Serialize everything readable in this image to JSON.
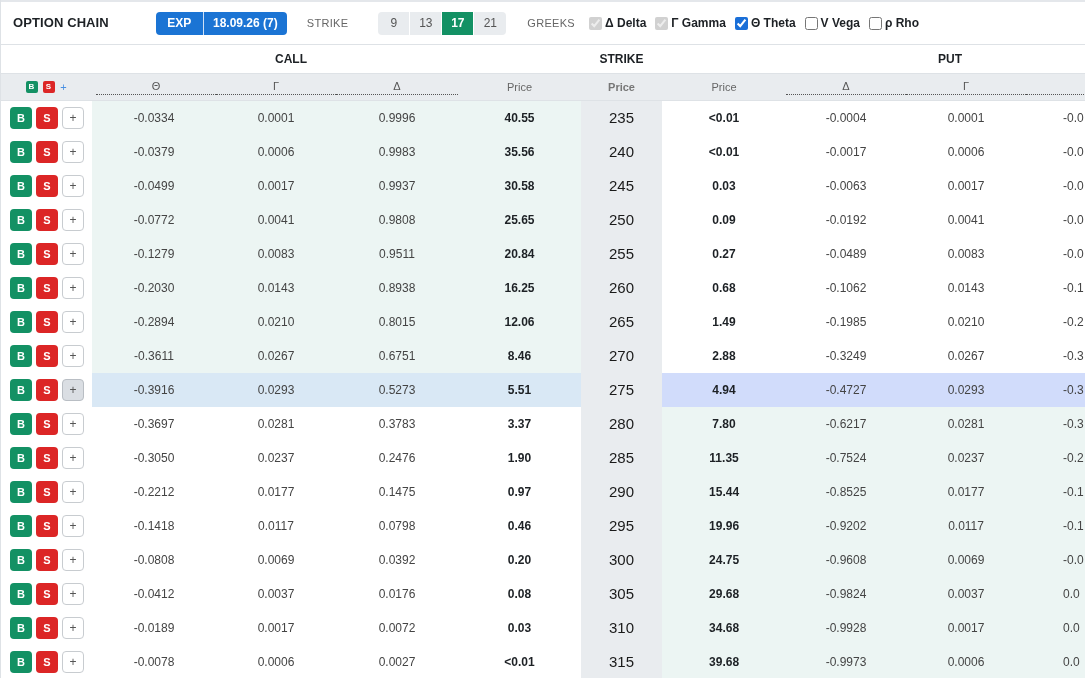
{
  "header": {
    "title": "OPTION CHAIN",
    "expiry": {
      "label": "EXP",
      "value": "18.09.26 (7)"
    },
    "strike_label": "STRIKE",
    "strike_counts": [
      {
        "label": "9",
        "selected": false
      },
      {
        "label": "13",
        "selected": false
      },
      {
        "label": "17",
        "selected": true
      },
      {
        "label": "21",
        "selected": false
      }
    ],
    "greeks_label": "GREEKS",
    "greeks": [
      {
        "label": "Δ Delta",
        "checked": true,
        "disabled": true
      },
      {
        "label": "Γ Gamma",
        "checked": true,
        "disabled": true
      },
      {
        "label": "Θ Theta",
        "checked": true,
        "disabled": false
      },
      {
        "label": "V Vega",
        "checked": false,
        "disabled": false
      },
      {
        "label": "ρ Rho",
        "checked": false,
        "disabled": false
      }
    ]
  },
  "table": {
    "call_title": "CALL",
    "strike_title": "STRIKE",
    "put_title": "PUT",
    "legend": {
      "buy": "B",
      "sell": "S",
      "add": "+"
    },
    "call_columns": [
      {
        "label": "Θ",
        "kind": "greek"
      },
      {
        "label": "Γ",
        "kind": "greek"
      },
      {
        "label": "Δ",
        "kind": "greek"
      },
      {
        "label": "Price",
        "kind": "price"
      }
    ],
    "strike_column": "Price",
    "put_columns": [
      {
        "label": "Price",
        "kind": "price"
      },
      {
        "label": "Δ",
        "kind": "greek"
      },
      {
        "label": "Γ",
        "kind": "greek"
      },
      {
        "kind": "greek"
      }
    ],
    "rows": [
      {
        "buy": "B",
        "sell": "S",
        "add": "+",
        "call": [
          "-0.0334",
          "0.0001",
          "0.9996",
          "40.55"
        ],
        "strike": "235",
        "put": [
          "<0.01",
          "-0.0004",
          "0.0001",
          "-0.0"
        ],
        "call_itm": true,
        "put_itm": false,
        "atm": false
      },
      {
        "buy": "B",
        "sell": "S",
        "add": "+",
        "call": [
          "-0.0379",
          "0.0006",
          "0.9983",
          "35.56"
        ],
        "strike": "240",
        "put": [
          "<0.01",
          "-0.0017",
          "0.0006",
          "-0.0"
        ],
        "call_itm": true,
        "put_itm": false,
        "atm": false
      },
      {
        "buy": "B",
        "sell": "S",
        "add": "+",
        "call": [
          "-0.0499",
          "0.0017",
          "0.9937",
          "30.58"
        ],
        "strike": "245",
        "put": [
          "0.03",
          "-0.0063",
          "0.0017",
          "-0.0"
        ],
        "call_itm": true,
        "put_itm": false,
        "atm": false
      },
      {
        "buy": "B",
        "sell": "S",
        "add": "+",
        "call": [
          "-0.0772",
          "0.0041",
          "0.9808",
          "25.65"
        ],
        "strike": "250",
        "put": [
          "0.09",
          "-0.0192",
          "0.0041",
          "-0.0"
        ],
        "call_itm": true,
        "put_itm": false,
        "atm": false
      },
      {
        "buy": "B",
        "sell": "S",
        "add": "+",
        "call": [
          "-0.1279",
          "0.0083",
          "0.9511",
          "20.84"
        ],
        "strike": "255",
        "put": [
          "0.27",
          "-0.0489",
          "0.0083",
          "-0.0"
        ],
        "call_itm": true,
        "put_itm": false,
        "atm": false
      },
      {
        "buy": "B",
        "sell": "S",
        "add": "+",
        "call": [
          "-0.2030",
          "0.0143",
          "0.8938",
          "16.25"
        ],
        "strike": "260",
        "put": [
          "0.68",
          "-0.1062",
          "0.0143",
          "-0.1"
        ],
        "call_itm": true,
        "put_itm": false,
        "atm": false
      },
      {
        "buy": "B",
        "sell": "S",
        "add": "+",
        "call": [
          "-0.2894",
          "0.0210",
          "0.8015",
          "12.06"
        ],
        "strike": "265",
        "put": [
          "1.49",
          "-0.1985",
          "0.0210",
          "-0.2"
        ],
        "call_itm": true,
        "put_itm": false,
        "atm": false
      },
      {
        "buy": "B",
        "sell": "S",
        "add": "+",
        "call": [
          "-0.3611",
          "0.0267",
          "0.6751",
          "8.46"
        ],
        "strike": "270",
        "put": [
          "2.88",
          "-0.3249",
          "0.0267",
          "-0.3"
        ],
        "call_itm": true,
        "put_itm": false,
        "atm": false
      },
      {
        "buy": "B",
        "sell": "S",
        "add": "+",
        "call": [
          "-0.3916",
          "0.0293",
          "0.5273",
          "5.51"
        ],
        "strike": "275",
        "put": [
          "4.94",
          "-0.4727",
          "0.0293",
          "-0.3"
        ],
        "call_itm": false,
        "put_itm": false,
        "atm": true
      },
      {
        "buy": "B",
        "sell": "S",
        "add": "+",
        "call": [
          "-0.3697",
          "0.0281",
          "0.3783",
          "3.37"
        ],
        "strike": "280",
        "put": [
          "7.80",
          "-0.6217",
          "0.0281",
          "-0.3"
        ],
        "call_itm": false,
        "put_itm": true,
        "atm": false
      },
      {
        "buy": "B",
        "sell": "S",
        "add": "+",
        "call": [
          "-0.3050",
          "0.0237",
          "0.2476",
          "1.90"
        ],
        "strike": "285",
        "put": [
          "11.35",
          "-0.7524",
          "0.0237",
          "-0.2"
        ],
        "call_itm": false,
        "put_itm": true,
        "atm": false
      },
      {
        "buy": "B",
        "sell": "S",
        "add": "+",
        "call": [
          "-0.2212",
          "0.0177",
          "0.1475",
          "0.97"
        ],
        "strike": "290",
        "put": [
          "15.44",
          "-0.8525",
          "0.0177",
          "-0.1"
        ],
        "call_itm": false,
        "put_itm": true,
        "atm": false
      },
      {
        "buy": "B",
        "sell": "S",
        "add": "+",
        "call": [
          "-0.1418",
          "0.0117",
          "0.0798",
          "0.46"
        ],
        "strike": "295",
        "put": [
          "19.96",
          "-0.9202",
          "0.0117",
          "-0.1"
        ],
        "call_itm": false,
        "put_itm": true,
        "atm": false
      },
      {
        "buy": "B",
        "sell": "S",
        "add": "+",
        "call": [
          "-0.0808",
          "0.0069",
          "0.0392",
          "0.20"
        ],
        "strike": "300",
        "put": [
          "24.75",
          "-0.9608",
          "0.0069",
          "-0.0"
        ],
        "call_itm": false,
        "put_itm": true,
        "atm": false
      },
      {
        "buy": "B",
        "sell": "S",
        "add": "+",
        "call": [
          "-0.0412",
          "0.0037",
          "0.0176",
          "0.08"
        ],
        "strike": "305",
        "put": [
          "29.68",
          "-0.9824",
          "0.0037",
          "0.0"
        ],
        "call_itm": false,
        "put_itm": true,
        "atm": false
      },
      {
        "buy": "B",
        "sell": "S",
        "add": "+",
        "call": [
          "-0.0189",
          "0.0017",
          "0.0072",
          "0.03"
        ],
        "strike": "310",
        "put": [
          "34.68",
          "-0.9928",
          "0.0017",
          "0.0"
        ],
        "call_itm": false,
        "put_itm": true,
        "atm": false
      },
      {
        "buy": "B",
        "sell": "S",
        "add": "+",
        "call": [
          "-0.0078",
          "0.0006",
          "0.0027",
          "<0.01"
        ],
        "strike": "315",
        "put": [
          "39.68",
          "-0.9973",
          "0.0006",
          "0.0"
        ],
        "call_itm": false,
        "put_itm": true,
        "atm": false
      }
    ]
  }
}
